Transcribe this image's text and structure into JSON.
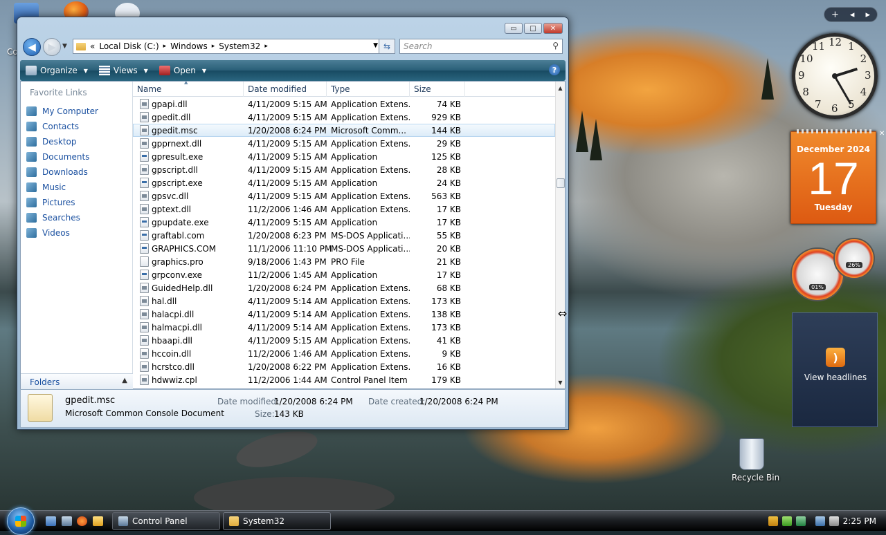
{
  "desktop": {
    "top_icon_label": "Co",
    "recycle_bin_label": "Recycle Bin"
  },
  "explorer": {
    "caption_buttons": {
      "minimize": "▭",
      "maximize": "□",
      "close": "✕"
    },
    "address": {
      "chevron": "«",
      "segments": [
        "Local Disk (C:)",
        "Windows",
        "System32"
      ],
      "separator": "▸"
    },
    "search_placeholder": "Search",
    "toolbar": {
      "organize": "Organize",
      "views": "Views",
      "open": "Open",
      "help": "?"
    },
    "nav": {
      "favorite_header": "Favorite Links",
      "items": [
        "My Computer",
        "Contacts",
        "Desktop",
        "Documents",
        "Downloads",
        "Music",
        "Pictures",
        "Searches",
        "Videos"
      ],
      "folders_label": "Folders"
    },
    "columns": [
      "Name",
      "Date modified",
      "Type",
      "Size"
    ],
    "rows": [
      {
        "name": "gpapi.dll",
        "date": "4/11/2009 5:15 AM",
        "type": "Application Extens...",
        "size": "74 KB",
        "icon": "dll"
      },
      {
        "name": "gpedit.dll",
        "date": "4/11/2009 5:15 AM",
        "type": "Application Extens...",
        "size": "929 KB",
        "icon": "dll"
      },
      {
        "name": "gpedit.msc",
        "date": "1/20/2008 6:24 PM",
        "type": "Microsoft Comm...",
        "size": "144 KB",
        "icon": "msc",
        "selected": true
      },
      {
        "name": "gpprnext.dll",
        "date": "4/11/2009 5:15 AM",
        "type": "Application Extens...",
        "size": "29 KB",
        "icon": "dll"
      },
      {
        "name": "gpresult.exe",
        "date": "4/11/2009 5:15 AM",
        "type": "Application",
        "size": "125 KB",
        "icon": "app"
      },
      {
        "name": "gpscript.dll",
        "date": "4/11/2009 5:15 AM",
        "type": "Application Extens...",
        "size": "28 KB",
        "icon": "dll"
      },
      {
        "name": "gpscript.exe",
        "date": "4/11/2009 5:15 AM",
        "type": "Application",
        "size": "24 KB",
        "icon": "app"
      },
      {
        "name": "gpsvc.dll",
        "date": "4/11/2009 5:15 AM",
        "type": "Application Extens...",
        "size": "563 KB",
        "icon": "dll"
      },
      {
        "name": "gptext.dll",
        "date": "11/2/2006 1:46 AM",
        "type": "Application Extens...",
        "size": "17 KB",
        "icon": "dll"
      },
      {
        "name": "gpupdate.exe",
        "date": "4/11/2009 5:15 AM",
        "type": "Application",
        "size": "17 KB",
        "icon": "app"
      },
      {
        "name": "graftabl.com",
        "date": "1/20/2008 6:23 PM",
        "type": "MS-DOS Applicati...",
        "size": "55 KB",
        "icon": "app"
      },
      {
        "name": "GRAPHICS.COM",
        "date": "11/1/2006 11:10 PM",
        "type": "MS-DOS Applicati...",
        "size": "20 KB",
        "icon": "app"
      },
      {
        "name": "graphics.pro",
        "date": "9/18/2006 1:43 PM",
        "type": "PRO File",
        "size": "21 KB",
        "icon": "plain"
      },
      {
        "name": "grpconv.exe",
        "date": "11/2/2006 1:45 AM",
        "type": "Application",
        "size": "17 KB",
        "icon": "app"
      },
      {
        "name": "GuidedHelp.dll",
        "date": "1/20/2008 6:24 PM",
        "type": "Application Extens...",
        "size": "68 KB",
        "icon": "dll"
      },
      {
        "name": "hal.dll",
        "date": "4/11/2009 5:14 AM",
        "type": "Application Extens...",
        "size": "173 KB",
        "icon": "dll"
      },
      {
        "name": "halacpi.dll",
        "date": "4/11/2009 5:14 AM",
        "type": "Application Extens...",
        "size": "138 KB",
        "icon": "dll"
      },
      {
        "name": "halmacpi.dll",
        "date": "4/11/2009 5:14 AM",
        "type": "Application Extens...",
        "size": "173 KB",
        "icon": "dll"
      },
      {
        "name": "hbaapi.dll",
        "date": "4/11/2009 5:15 AM",
        "type": "Application Extens...",
        "size": "41 KB",
        "icon": "dll"
      },
      {
        "name": "hccoin.dll",
        "date": "11/2/2006 1:46 AM",
        "type": "Application Extens...",
        "size": "9 KB",
        "icon": "dll"
      },
      {
        "name": "hcrstco.dll",
        "date": "1/20/2008 6:22 PM",
        "type": "Application Extens...",
        "size": "16 KB",
        "icon": "dll"
      },
      {
        "name": "hdwwiz.cpl",
        "date": "11/2/2006 1:44 AM",
        "type": "Control Panel Item",
        "size": "179 KB",
        "icon": "dll"
      }
    ],
    "details": {
      "name": "gpedit.msc",
      "type": "Microsoft Common Console Document",
      "date_modified_label": "Date modified:",
      "date_modified": "1/20/2008 6:24 PM",
      "date_created_label": "Date created:",
      "date_created": "1/20/2008 6:24 PM",
      "size_label": "Size:",
      "size": "143 KB"
    }
  },
  "gadgets": {
    "top_controls": [
      "+",
      "◂",
      "▸"
    ],
    "clock": {
      "numbers": [
        "12",
        "1",
        "2",
        "3",
        "4",
        "5",
        "6",
        "7",
        "8",
        "9",
        "10",
        "11"
      ],
      "hour": 2,
      "minute": 25
    },
    "calendar": {
      "month": "December 2024",
      "day": "17",
      "weekday": "Tuesday",
      "close": "✕"
    },
    "meters": {
      "cpu": "01%",
      "memory": "26%"
    },
    "feed": {
      "label": "View headlines"
    }
  },
  "taskbar": {
    "tasks": [
      "Control Panel",
      "System32"
    ],
    "time": "2:25 PM"
  },
  "colors": {
    "accent": "#1a50a0",
    "toolbar": "#2a5f78",
    "calendar": "#e8701e",
    "selection": "#dbebf8"
  }
}
